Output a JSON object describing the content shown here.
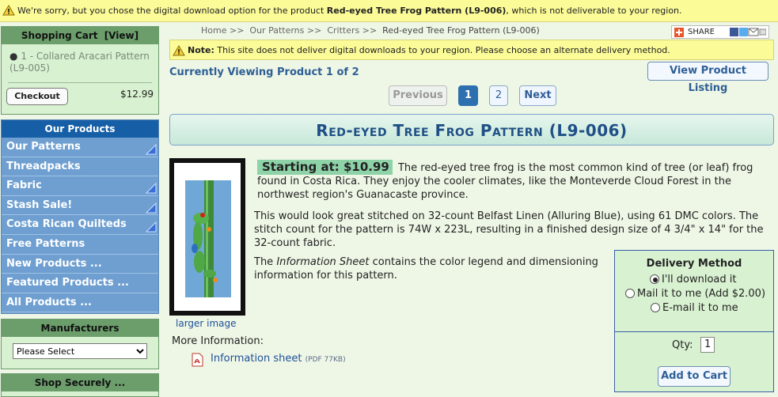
{
  "warning": {
    "prefix": "We're sorry, but you chose the digital download option for the product ",
    "product": "Red-eyed Tree Frog Pattern (L9-006)",
    "suffix": ", which is not deliverable to your region."
  },
  "cart": {
    "title": "Shopping Cart",
    "view_label": "[View]",
    "item": "1 - Collared Aracari Pattern (L9-005)",
    "checkout_label": "Checkout",
    "total": "$12.99"
  },
  "products_nav": {
    "title": "Our Products",
    "items": [
      {
        "label": "Our Patterns",
        "has_submenu": true
      },
      {
        "label": "Threadpacks",
        "has_submenu": false
      },
      {
        "label": "Fabric",
        "has_submenu": true
      },
      {
        "label": "Stash Sale!",
        "has_submenu": true
      },
      {
        "label": "Costa Rican Quilteds",
        "has_submenu": true
      },
      {
        "label": "Free Patterns",
        "has_submenu": false
      },
      {
        "label": "New Products ...",
        "has_submenu": false
      },
      {
        "label": "Featured Products ...",
        "has_submenu": false
      },
      {
        "label": "All Products ...",
        "has_submenu": false
      }
    ]
  },
  "manufacturers": {
    "title": "Manufacturers",
    "selected": "Please Select"
  },
  "shop_securely": "Shop Securely ...",
  "breadcrumb": {
    "home": "Home",
    "patterns": "Our Patterns",
    "critters": "Critters",
    "current": "Red-eyed Tree Frog Pattern (L9-006)",
    "sep": ">>"
  },
  "share_label": "SHARE",
  "note": {
    "label": "Note:",
    "text": " This site does not deliver digital downloads to your region. Please choose an alternate delivery method."
  },
  "viewing": "Currently Viewing Product 1 of 2",
  "view_listing_label": "View Product Listing",
  "pagination": {
    "previous": "Previous",
    "page1": "1",
    "page2": "2",
    "next": "Next"
  },
  "product": {
    "title": "Red-eyed Tree Frog Pattern (L9-006)",
    "starting_at": "Starting at: $10.99",
    "desc1": "The red-eyed tree frog is the most common kind of tree (or leaf) frog found in Costa Rica. They enjoy the cooler climates, like the Monteverde Cloud Forest in the northwest region's Guanacaste province.",
    "desc2": "This would look great stitched on 32-count Belfast Linen (Alluring Blue), using 61 DMC colors. The stitch count for the pattern is 74W x 223L, resulting in a finished design size of 4 3/4\" x 14\" for the 32-count fabric.",
    "desc3_pre": "The ",
    "desc3_em": "Information Sheet",
    "desc3_post": " contains the color legend and dimensioning information for this pattern.",
    "larger_image": "larger image",
    "more_info": "More Information:",
    "info_sheet": "Information sheet",
    "info_sheet_size": "(PDF 77KB)"
  },
  "delivery": {
    "title": "Delivery Method",
    "options": [
      "I'll download it",
      "Mail it to me (Add $2.00)",
      "E-mail it to me"
    ],
    "selected_index": 0,
    "qty_label": "Qty:",
    "qty_value": "1",
    "add_to_cart": "Add to Cart"
  },
  "colors": {
    "accent_blue": "#1f4f86",
    "nav_blue": "#6e9fd0",
    "warning_yellow": "#fbfb98",
    "panel_green": "#d8f1d0"
  }
}
